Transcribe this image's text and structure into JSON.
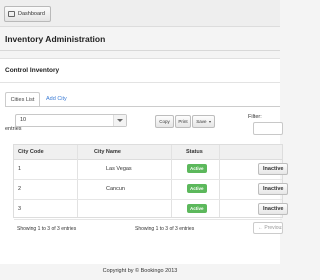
{
  "topbar": {
    "dashboard_label": "Dashboard"
  },
  "page": {
    "title": "Inventory Administration"
  },
  "section": {
    "title": "Control Inventory"
  },
  "tabs": [
    {
      "label": "Cities List",
      "active": true
    },
    {
      "label": "Add City",
      "active": false
    }
  ],
  "table_controls": {
    "page_length": "10",
    "entries_label": "entries",
    "copy_label": "Copy",
    "print_label": "Print",
    "save_label": "Save",
    "filter_label": "Filter:",
    "filter_value": ""
  },
  "table": {
    "headers": [
      "City Code",
      "City Name",
      "Status"
    ],
    "rows": [
      {
        "code": "1",
        "name": "Las Vegas",
        "status": "Active",
        "action": "Inactive"
      },
      {
        "code": "2",
        "name": "Cancun",
        "status": "Active",
        "action": "Inactive"
      },
      {
        "code": "3",
        "name": "",
        "status": "Active",
        "action": "Inactive"
      }
    ]
  },
  "pagination": {
    "info_left": "Showing 1 to 3 of 3 entries",
    "info_right": "Showing 1 to 3 of 3 entries",
    "prev_label": "← Previous"
  },
  "footer": {
    "text": "Copyright by © Bookingo 2013"
  },
  "colors": {
    "active_badge": "#5cb85c",
    "link": "#3a7bd5"
  }
}
